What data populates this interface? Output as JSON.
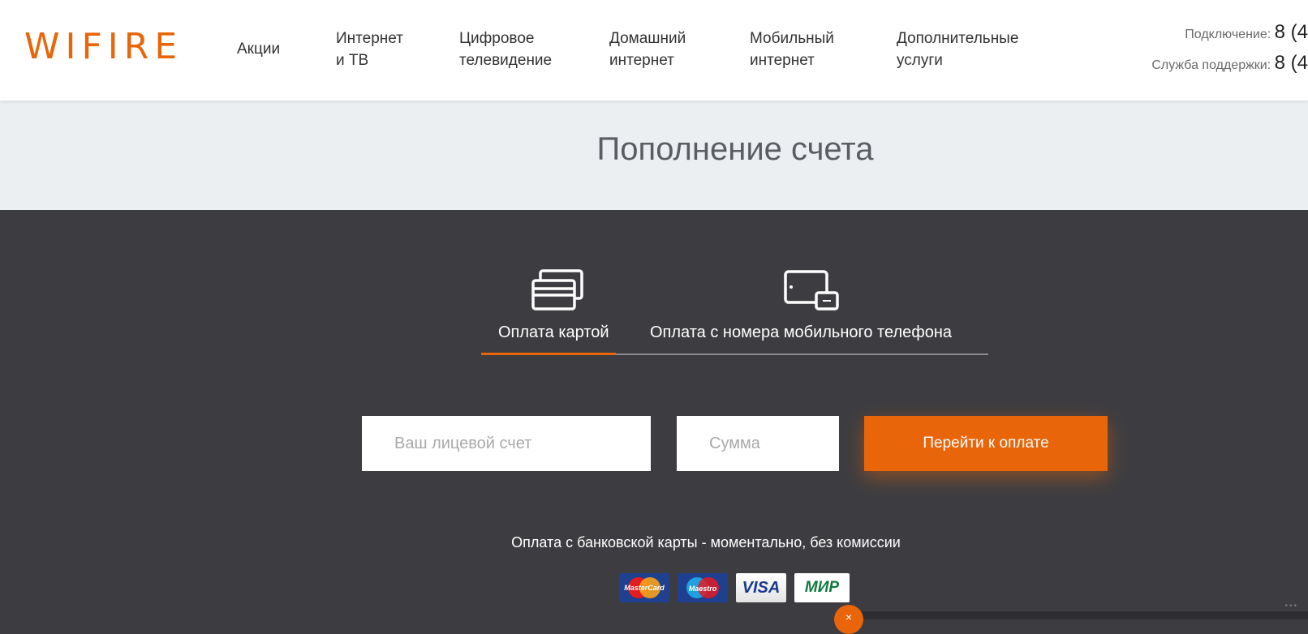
{
  "brand": {
    "logo_text": "WIFIRE",
    "accent_color": "#e8650a"
  },
  "nav": {
    "items": [
      {
        "label_line1": "Акции",
        "label_line2": ""
      },
      {
        "label_line1": "Интернет",
        "label_line2": "и ТВ"
      },
      {
        "label_line1": "Цифровое",
        "label_line2": "телевидение"
      },
      {
        "label_line1": "Домашний",
        "label_line2": "интернет"
      },
      {
        "label_line1": "Мобильный",
        "label_line2": "интернет"
      },
      {
        "label_line1": "Дополнительные",
        "label_line2": "услуги"
      }
    ]
  },
  "contacts": {
    "connection_label": "Подключение:",
    "connection_value": "8 (4",
    "support_label": "Служба поддержки:",
    "support_value": "8 (4"
  },
  "page": {
    "title": "Пополнение счета"
  },
  "tabs": [
    {
      "label": "Оплата картой",
      "icon": "credit-card-icon",
      "active": true
    },
    {
      "label": "Оплата с номера мобильного телефона",
      "icon": "mobile-devices-icon",
      "active": false
    }
  ],
  "form": {
    "account_placeholder": "Ваш лицевой счет",
    "amount_placeholder": "Сумма",
    "submit_label": "Перейти к оплате"
  },
  "note": "Оплата с банковской карты - моментально, без комиссии",
  "payment_logos": [
    {
      "name": "MasterCard",
      "text": "MasterCard"
    },
    {
      "name": "Maestro",
      "text": "Maestro"
    },
    {
      "name": "VISA",
      "text": "VISA"
    },
    {
      "name": "МИР",
      "text": "МИР"
    }
  ],
  "chat": {
    "icon": "close-chevron-icon",
    "glyph": "×"
  }
}
